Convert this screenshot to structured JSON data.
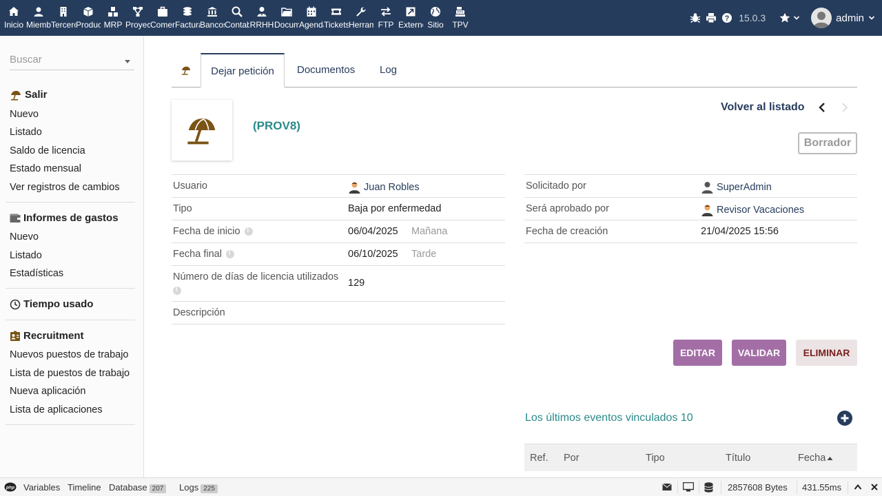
{
  "topbar": {
    "menus": [
      {
        "label": "Inicio",
        "icon": "home-icon"
      },
      {
        "label": "Miembros",
        "icon": "user-icon"
      },
      {
        "label": "Terceros",
        "icon": "building-icon"
      },
      {
        "label": "Productos",
        "icon": "cube-icon"
      },
      {
        "label": "MRP",
        "icon": "cubes-icon"
      },
      {
        "label": "Proyectos",
        "icon": "project-icon"
      },
      {
        "label": "Comercial",
        "icon": "briefcase-icon"
      },
      {
        "label": "Facturación",
        "icon": "coins-icon"
      },
      {
        "label": "Bancos",
        "icon": "bank-icon"
      },
      {
        "label": "Contabilidad",
        "icon": "search-dollar-icon"
      },
      {
        "label": "RRHH",
        "icon": "user-tie-icon"
      },
      {
        "label": "Documentos",
        "icon": "folder-icon"
      },
      {
        "label": "Agenda",
        "icon": "calendar-icon"
      },
      {
        "label": "Tickets",
        "icon": "ticket-icon"
      },
      {
        "label": "Herramientas",
        "icon": "wrench-icon"
      },
      {
        "label": "FTP",
        "icon": "exchange-icon"
      },
      {
        "label": "Externo",
        "icon": "external-icon"
      },
      {
        "label": "Sitio",
        "icon": "globe-icon"
      },
      {
        "label": "TPV",
        "icon": "cash-register-icon"
      }
    ],
    "version": "15.0.3",
    "username": "admin"
  },
  "sidebar": {
    "search_placeholder": "Buscar",
    "blocks": [
      {
        "title": "Salir",
        "icon": "beach-umbrella-icon",
        "items": [
          "Nuevo",
          "Listado",
          "Saldo de licencia",
          "Estado mensual",
          "Ver registros de cambios"
        ]
      },
      {
        "title": "Informes de gastos",
        "icon": "wallet-icon",
        "items": [
          "Nuevo",
          "Listado",
          "Estadísticas"
        ]
      },
      {
        "title": "Tiempo usado",
        "icon": "clock-icon",
        "items": []
      },
      {
        "title": "Recruitment",
        "icon": "id-badge-icon",
        "items": [
          "Nuevos puestos de trabajo",
          "Lista de puestos de trabajo",
          "Nueva aplicación",
          "Lista de aplicaciones"
        ]
      }
    ]
  },
  "tabs": {
    "card": "Dejar petición",
    "documents": "Documentos",
    "log": "Log"
  },
  "record": {
    "ref": "(PROV8)",
    "back_link": "Volver al listado",
    "status": "Borrador"
  },
  "left_fields": [
    {
      "label": "Usuario",
      "value": "Juan Robles"
    },
    {
      "label": "Tipo",
      "value": "Baja por enfermedad"
    },
    {
      "label": "Fecha de inicio",
      "value": "06/04/2025",
      "sub": "Mañana"
    },
    {
      "label": "Fecha final",
      "value": "06/10/2025",
      "sub": "Tarde"
    },
    {
      "label": "Número de días de licencia utilizados",
      "value": "129"
    },
    {
      "label": "Descripción",
      "value": ""
    }
  ],
  "right_fields": [
    {
      "label": "Solicitado por",
      "value": "SuperAdmin"
    },
    {
      "label": "Será aprobado por",
      "value": "Revisor Vacaciones"
    },
    {
      "label": "Fecha de creación",
      "value": "21/04/2025 15:56"
    }
  ],
  "actions": {
    "edit": "EDITAR",
    "validate": "VALIDAR",
    "delete": "ELIMINAR"
  },
  "events": {
    "title": "Los últimos eventos vinculados 10",
    "columns": [
      "Ref.",
      "Por",
      "Tipo",
      "Título",
      "Fecha"
    ]
  },
  "debugbar": {
    "variables": "Variables",
    "timeline": "Timeline",
    "database": "Database",
    "database_count": "207",
    "logs": "Logs",
    "logs_count": "225",
    "memory": "2857608 Bytes",
    "time": "431.55ms"
  },
  "colors": {
    "topbar": "#263c5c",
    "accent_purple": "#a36ea5",
    "teal": "#2a8a8a",
    "umbrella_brown": "#7a5416"
  }
}
